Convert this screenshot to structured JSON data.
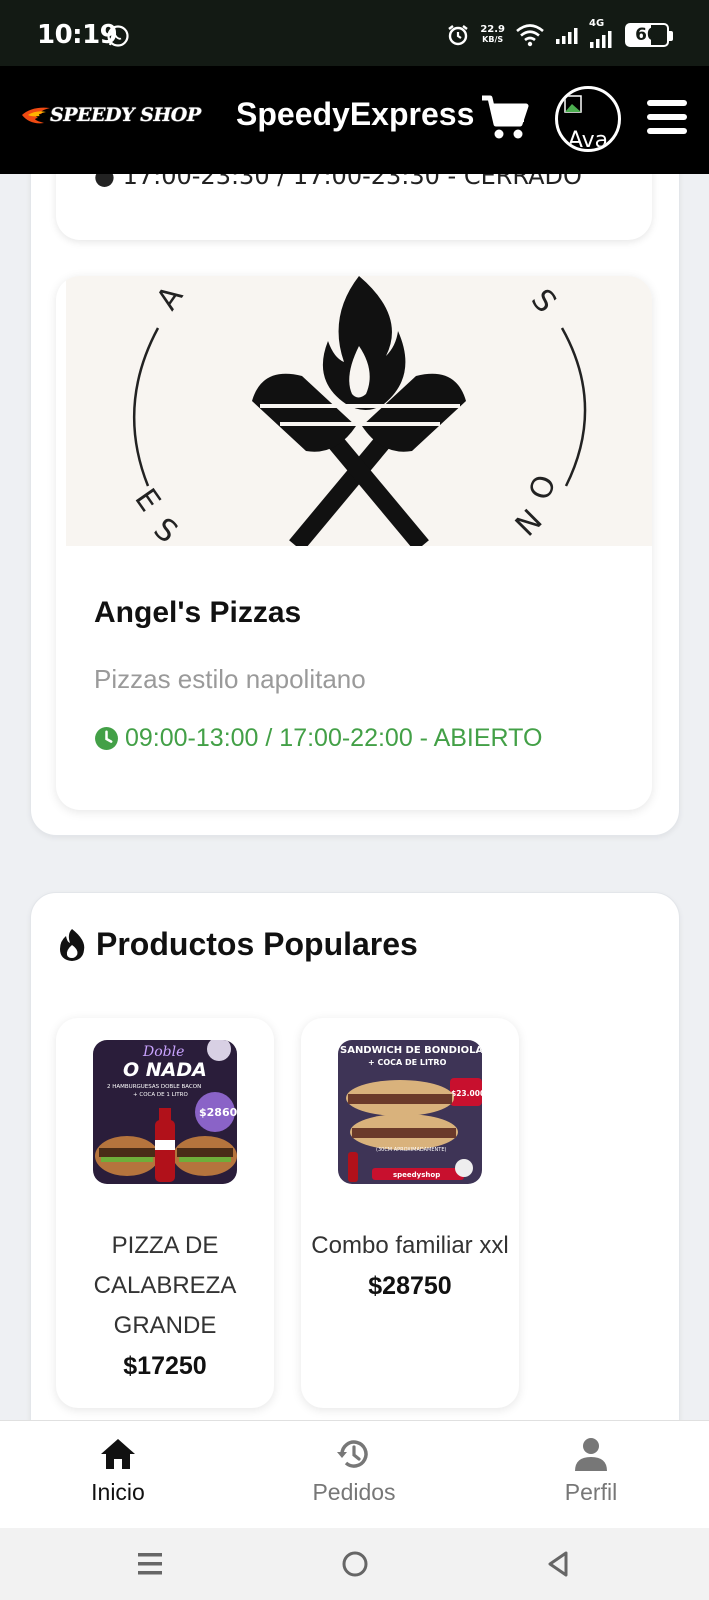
{
  "status_bar": {
    "time": "10:19",
    "net_speed_value": "22.9",
    "net_speed_unit": "KB/S",
    "network_label": "4G",
    "battery": "60"
  },
  "header": {
    "logo_text": "SPEEDY SHOP",
    "brand": "SpeedyExpress",
    "cart_count": "0",
    "avatar_alt": "Ava"
  },
  "stores": {
    "previous_card_hours": "17:00-23:30 / 17:00-23:30 - CERRADO",
    "items": [
      {
        "name": "Angel's Pizzas",
        "description": "Pizzas estilo napolitano",
        "hours": "09:00-13:00 / 17:00-22:00 - ABIERTO",
        "status_color": "#43a047"
      }
    ]
  },
  "popular": {
    "title": "Productos Populares",
    "products": [
      {
        "name": "PIZZA DE CALABREZA GRANDE",
        "price": "$17250",
        "image_lines": [
          "Doble",
          "O NADA",
          "2 HAMBURGUESAS DOBLE BACON",
          "+ COCA DE 1 LITRO",
          "$28600"
        ]
      },
      {
        "name": "Combo familiar xxl",
        "price": "$28750",
        "image_lines": [
          "SANDWICH DE BONDIOLA",
          "+ COCA DE LITRO",
          "$23.000",
          "(30CM APROXIMADAMENTE)",
          "speedyshop"
        ]
      }
    ]
  },
  "bottom_nav": {
    "items": [
      {
        "label": "Inicio",
        "icon": "home-icon",
        "active": true
      },
      {
        "label": "Pedidos",
        "icon": "history-icon",
        "active": false
      },
      {
        "label": "Perfil",
        "icon": "person-icon",
        "active": false
      }
    ]
  },
  "colors": {
    "header_bg": "#000000",
    "open_green": "#43a047",
    "page_bg": "#eef0f3"
  }
}
